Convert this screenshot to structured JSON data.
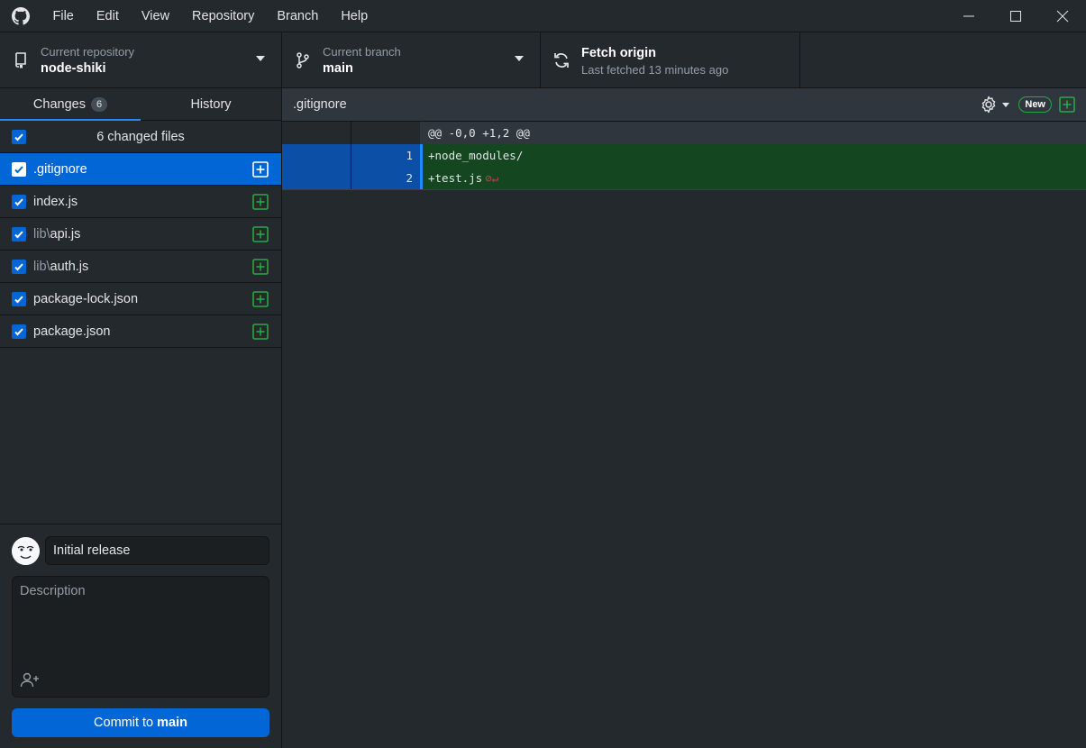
{
  "menu": [
    "File",
    "Edit",
    "View",
    "Repository",
    "Branch",
    "Help"
  ],
  "toolbar": {
    "repo": {
      "desc": "Current repository",
      "name": "node-shiki"
    },
    "branch": {
      "desc": "Current branch",
      "name": "main"
    },
    "fetch": {
      "title": "Fetch origin",
      "desc": "Last fetched 13 minutes ago"
    }
  },
  "tabs": {
    "changes": "Changes",
    "changes_count": "6",
    "history": "History"
  },
  "changes": {
    "header": "6 changed files",
    "files": [
      {
        "dir": "",
        "name": ".gitignore",
        "selected": true
      },
      {
        "dir": "",
        "name": "index.js",
        "selected": false
      },
      {
        "dir": "lib\\",
        "name": "api.js",
        "selected": false
      },
      {
        "dir": "lib\\",
        "name": "auth.js",
        "selected": false
      },
      {
        "dir": "",
        "name": "package-lock.json",
        "selected": false
      },
      {
        "dir": "",
        "name": "package.json",
        "selected": false
      }
    ]
  },
  "commit": {
    "summary_value": "Initial release",
    "description_placeholder": "Description",
    "button_prefix": "Commit to",
    "button_branch": "main"
  },
  "diff": {
    "path": ".gitignore",
    "new_badge": "New",
    "hunk": "@@ -0,0 +1,2 @@",
    "lines": [
      {
        "num": "1",
        "text": "+node_modules/",
        "noeol": false
      },
      {
        "num": "2",
        "text": "+test.js",
        "noeol": true
      }
    ]
  },
  "colors": {
    "accent": "#0366d6",
    "added": "#28a745",
    "diff_add_bg": "#144620"
  }
}
